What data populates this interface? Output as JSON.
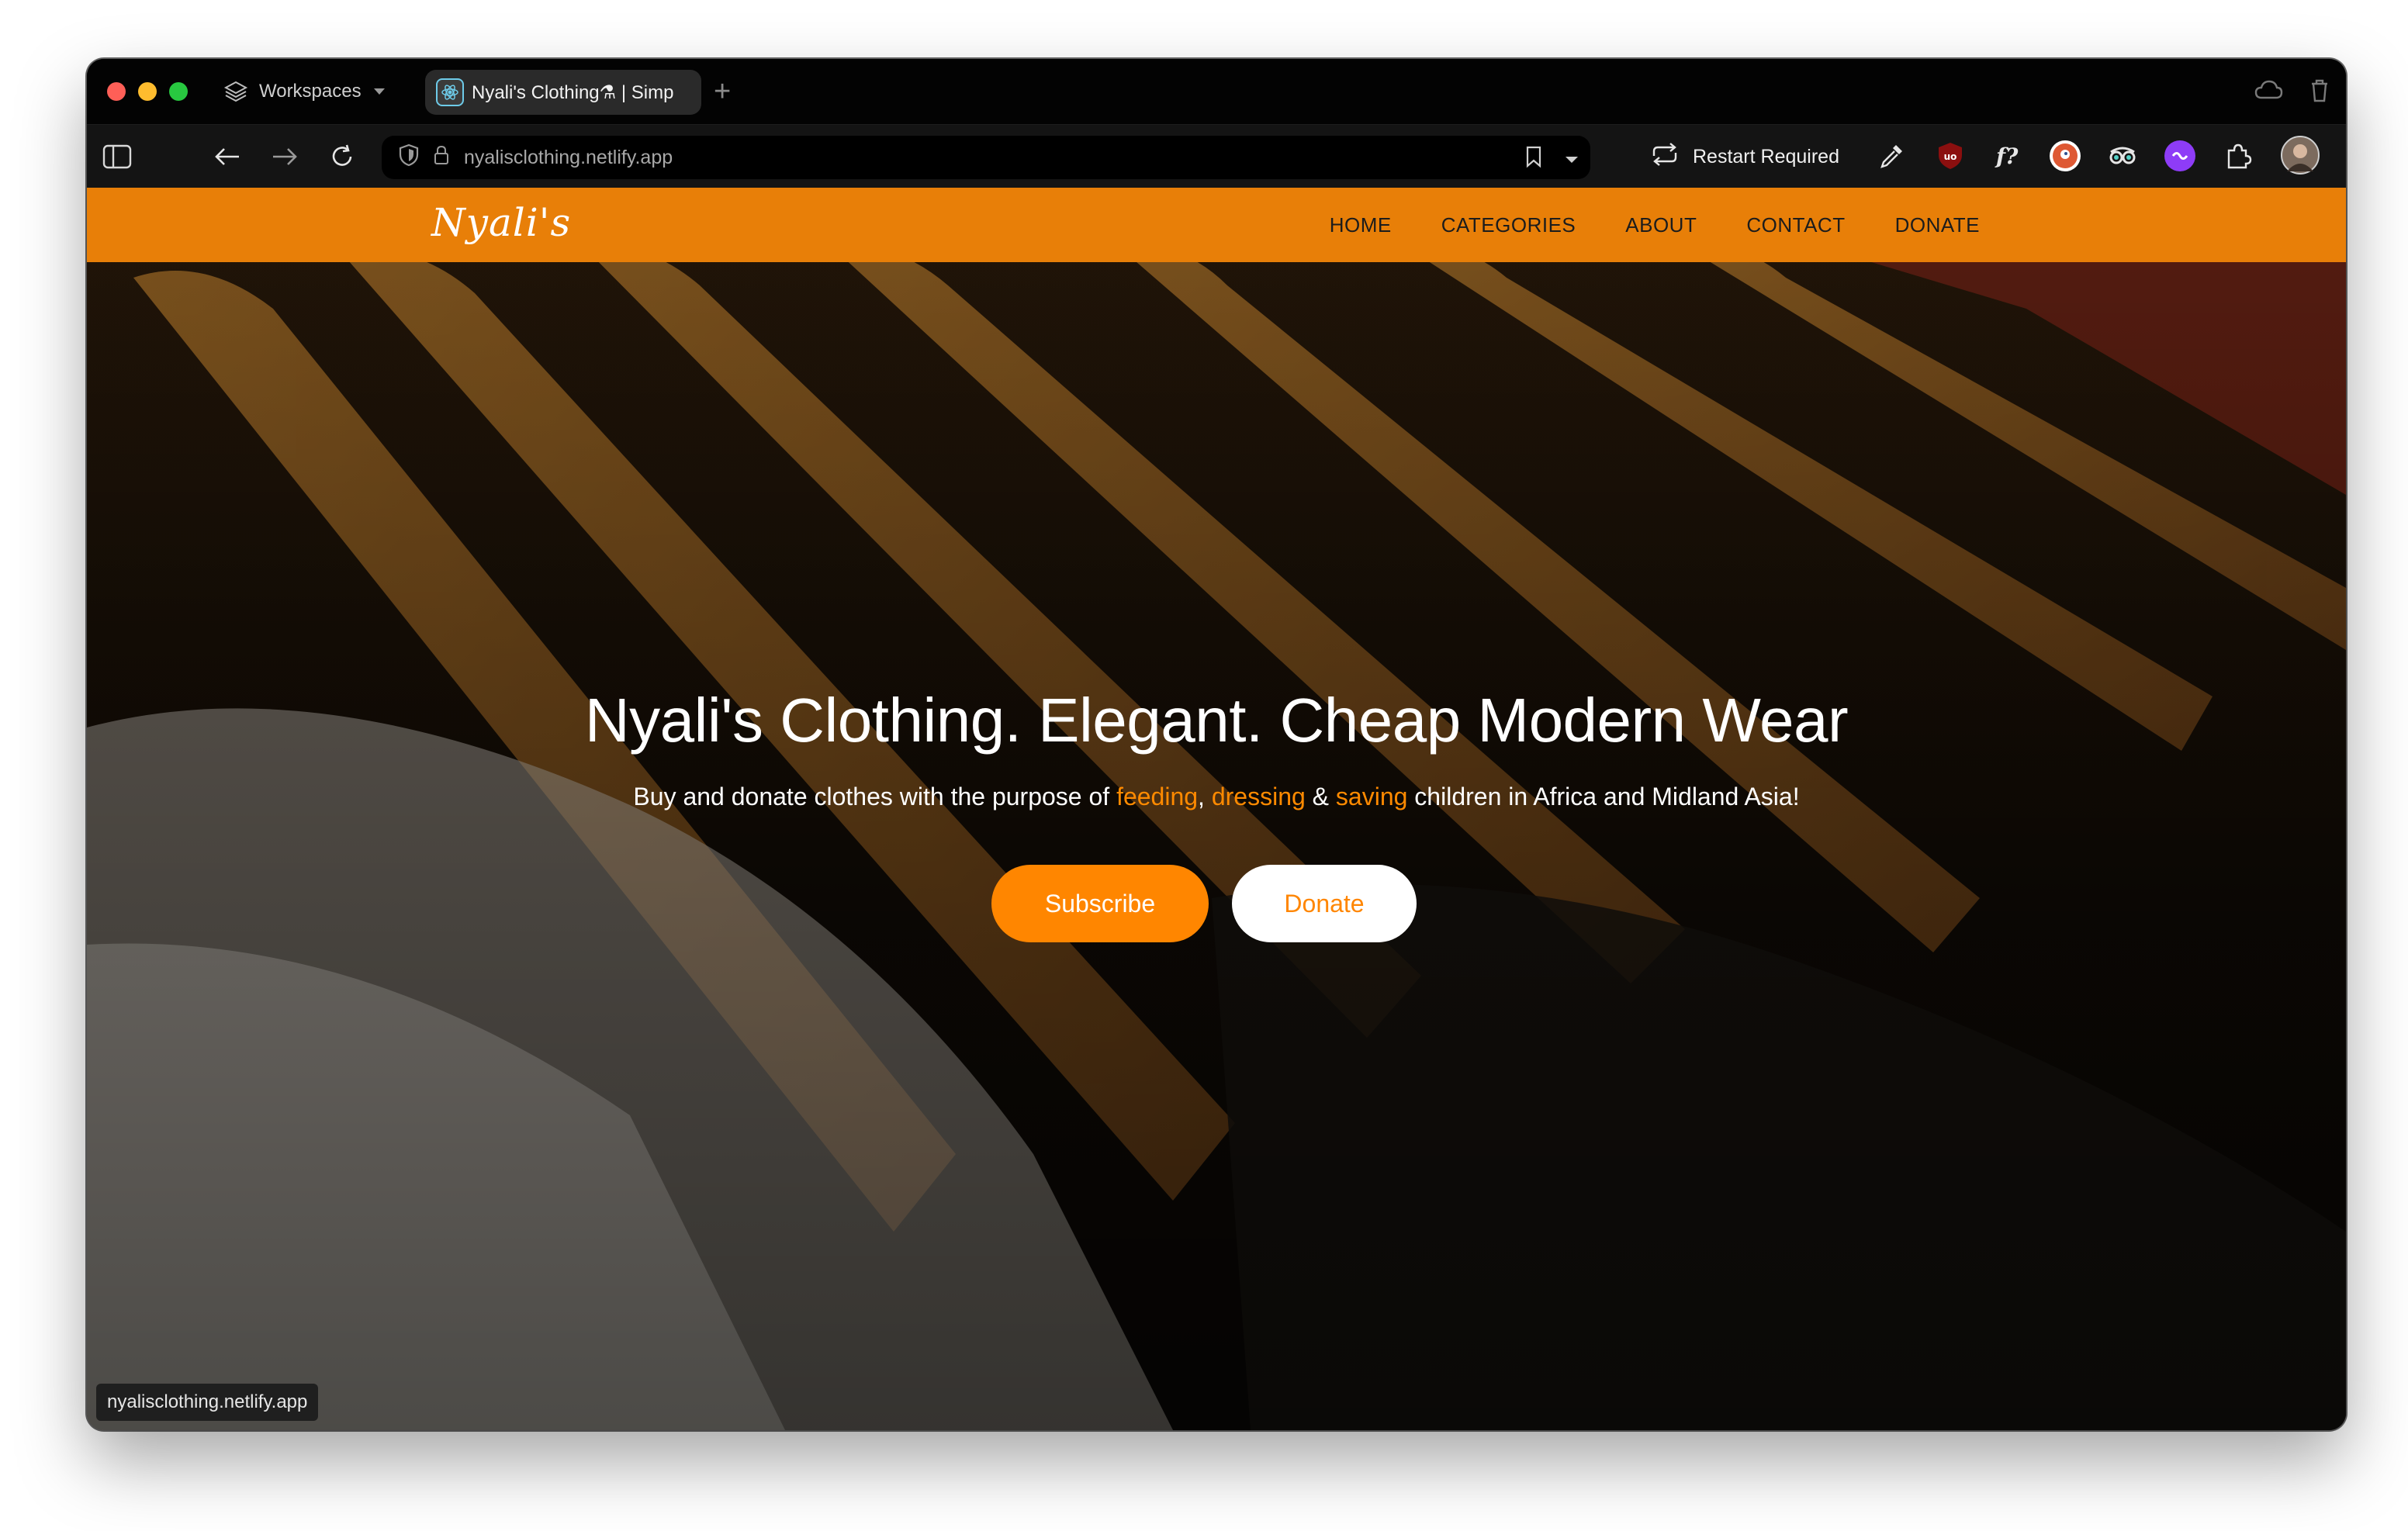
{
  "browser": {
    "workspaces_label": "Workspaces",
    "tab_title": "Nyali's Clothing⚗ | Simp",
    "new_tab_symbol": "+",
    "url": "nyalisclothing.netlify.app",
    "restart_label": "Restart Required",
    "status_url": "nyalisclothing.netlify.app",
    "extensions": [
      "eyedropper-icon",
      "ublock-icon",
      "fontface-icon",
      "duckduckgo-icon",
      "privacy-icon",
      "purple-ext-icon",
      "puzzle-icon"
    ]
  },
  "site": {
    "brand": "Nyali's",
    "nav": [
      "HOME",
      "CATEGORIES",
      "ABOUT",
      "CONTACT",
      "DONATE"
    ],
    "hero": {
      "title": "Nyali's Clothing. Elegant. Cheap Modern Wear",
      "subtitle_parts": {
        "before": "Buy and donate clothes with the purpose of ",
        "feeding": "feeding",
        "comma": ", ",
        "dressing": "dressing",
        "amp": " & ",
        "saving": "saving",
        "after": " children in Africa and Midland Asia!"
      },
      "subscribe_label": "Subscribe",
      "donate_label": "Donate"
    },
    "colors": {
      "accent": "#e87f08",
      "button_orange": "#ff8600"
    }
  }
}
